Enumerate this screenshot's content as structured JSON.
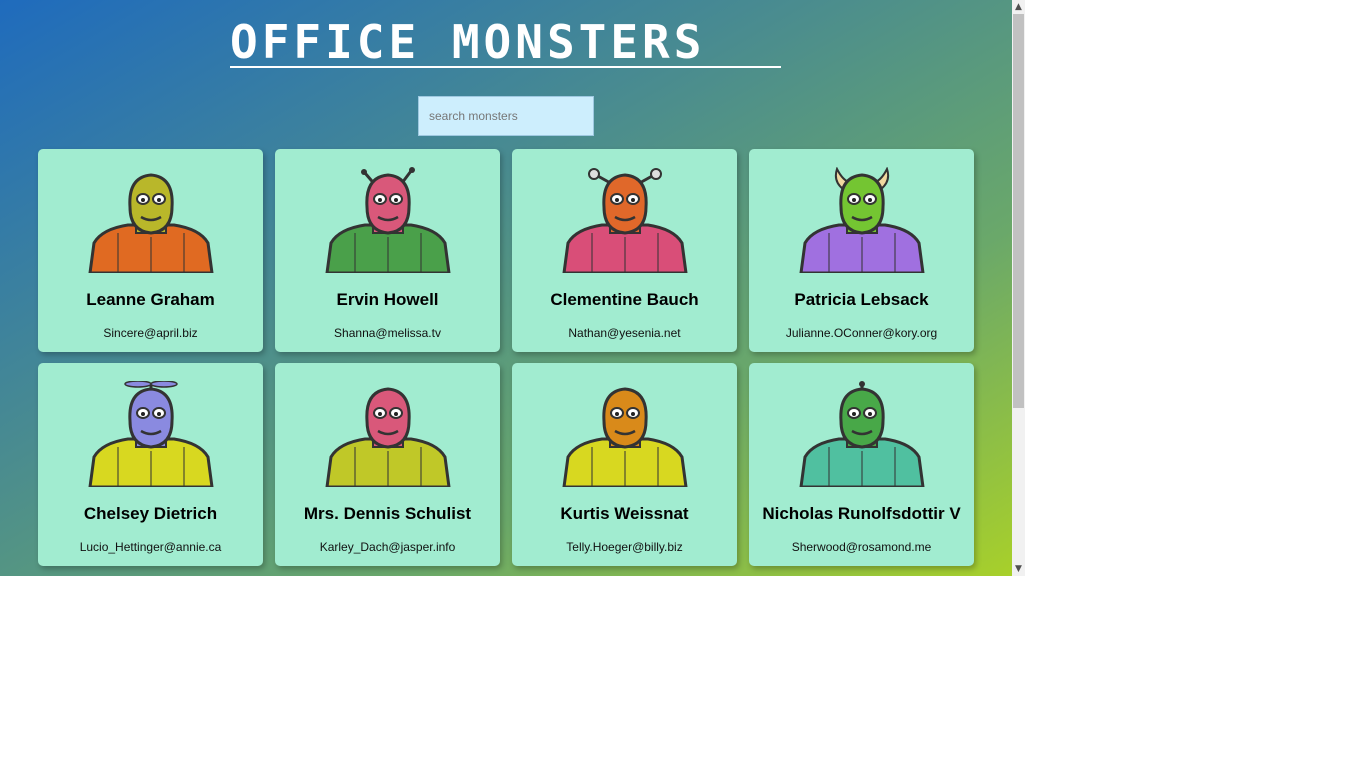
{
  "header": {
    "title": "OFFICE MONSTERS"
  },
  "search": {
    "placeholder": "search monsters",
    "value": ""
  },
  "monsters": [
    {
      "name": "Leanne Graham",
      "email": "Sincere@april.biz",
      "skin": "#b9b72a",
      "body": "#e06a22",
      "feature": "none"
    },
    {
      "name": "Ervin Howell",
      "email": "Shanna@melissa.tv",
      "skin": "#d9587a",
      "body": "#4aa04a",
      "feature": "antennae"
    },
    {
      "name": "Clementine Bauch",
      "email": "Nathan@yesenia.net",
      "skin": "#e0682a",
      "body": "#d94e78",
      "feature": "eyestalks"
    },
    {
      "name": "Patricia Lebsack",
      "email": "Julianne.OConner@kory.org",
      "skin": "#74c532",
      "body": "#a070e0",
      "feature": "horns"
    },
    {
      "name": "Chelsey Dietrich",
      "email": "Lucio_Hettinger@annie.ca",
      "skin": "#8a8ae0",
      "body": "#d8d820",
      "feature": "propeller"
    },
    {
      "name": "Mrs. Dennis Schulist",
      "email": "Karley_Dach@jasper.info",
      "skin": "#d9587a",
      "body": "#c0c828",
      "feature": "none"
    },
    {
      "name": "Kurtis Weissnat",
      "email": "Telly.Hoeger@billy.biz",
      "skin": "#d98a1a",
      "body": "#d8d820",
      "feature": "none"
    },
    {
      "name": "Nicholas Runolfsdottir V",
      "email": "Sherwood@rosamond.me",
      "skin": "#48a848",
      "body": "#50c0a0",
      "feature": "eyestalk-single"
    }
  ]
}
